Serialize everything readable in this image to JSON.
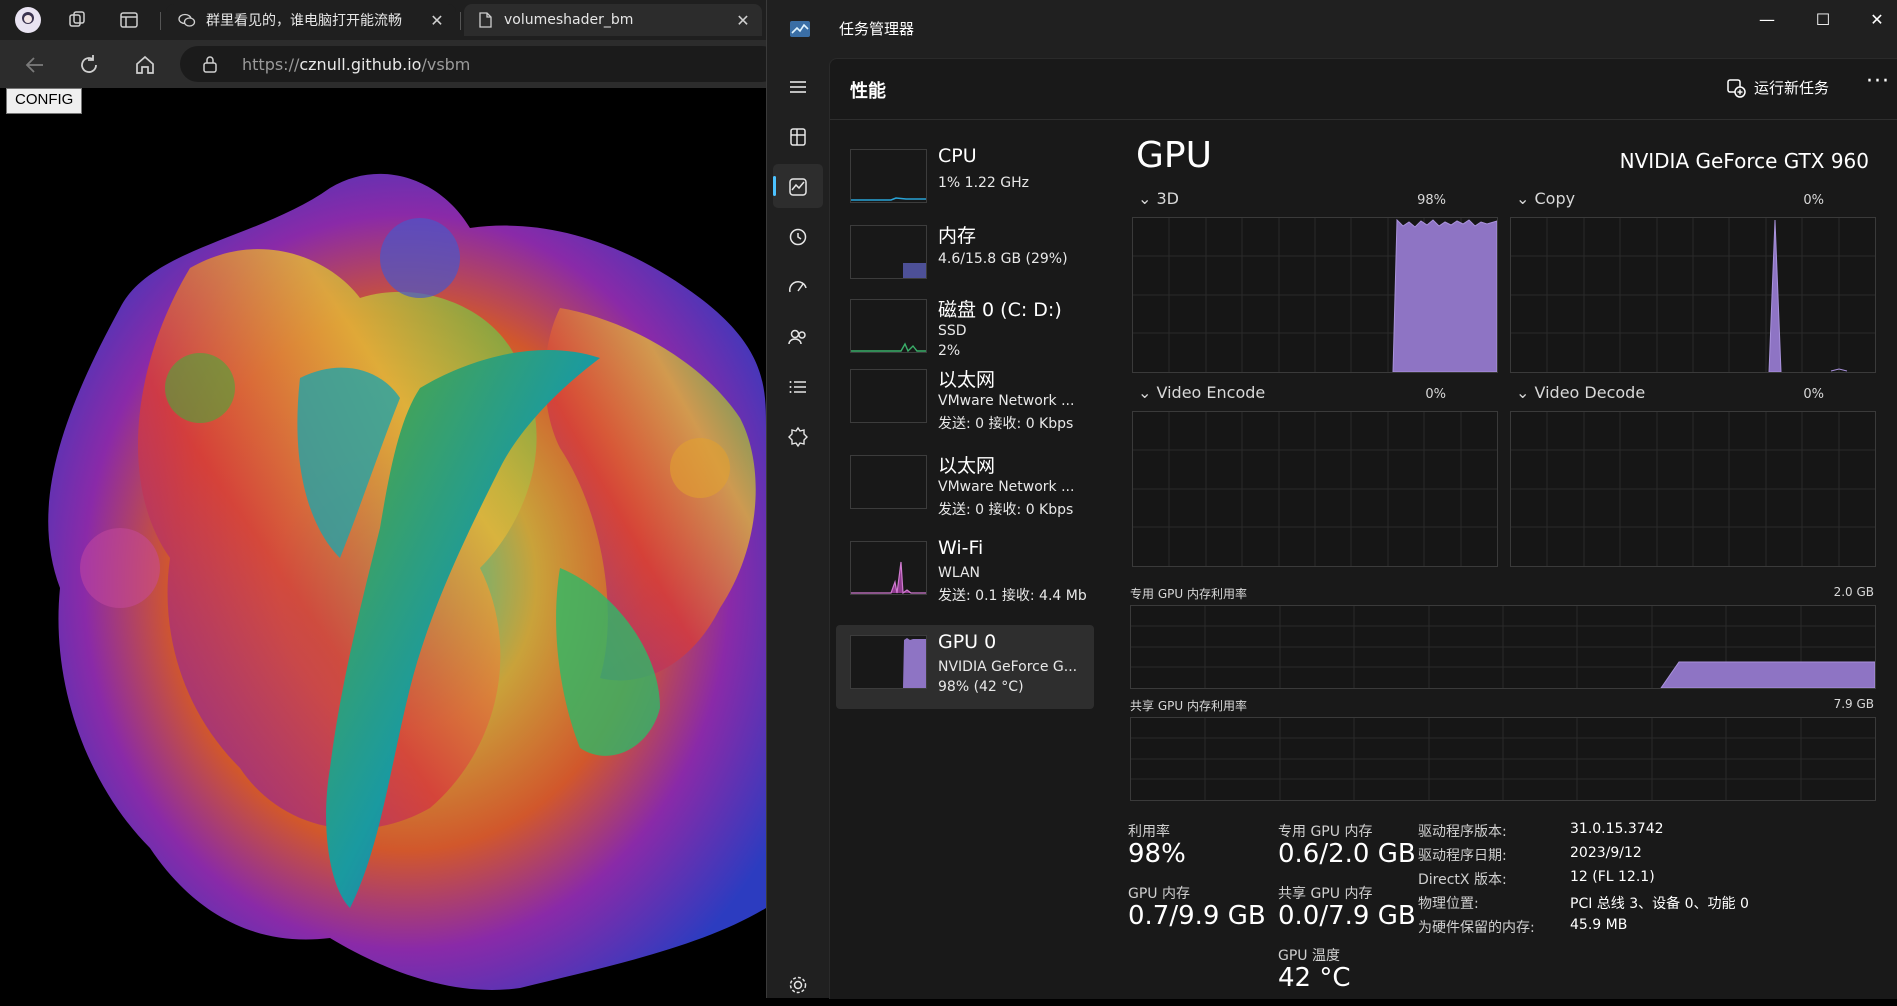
{
  "browser": {
    "tabs": [
      {
        "title": "群里看见的，谁电脑打开能流畅",
        "icon": "chat-icon"
      },
      {
        "title": "volumeshader_bm",
        "icon": "page-icon"
      }
    ],
    "url": {
      "scheme": "https://",
      "host": "cznull.github.io",
      "path": "/vsbm"
    },
    "config_label": "CONFIG"
  },
  "taskmanager": {
    "title": "任务管理器",
    "page_title": "性能",
    "run_task_label": "运行新任务",
    "more_label": "···",
    "sidebar": [
      {
        "name": "CPU",
        "sub1": "1% 1.22 GHz",
        "sub2": ""
      },
      {
        "name": "内存",
        "sub1": "4.6/15.8 GB (29%)",
        "sub2": ""
      },
      {
        "name": "磁盘 0 (C: D:)",
        "sub1": "SSD",
        "sub2": "2%"
      },
      {
        "name": "以太网",
        "sub1": "VMware Network ...",
        "sub2": "发送: 0 接收: 0 Kbps"
      },
      {
        "name": "以太网",
        "sub1": "VMware Network ...",
        "sub2": "发送: 0 接收: 0 Kbps"
      },
      {
        "name": "Wi-Fi",
        "sub1": "WLAN",
        "sub2": "发送: 0.1 接收: 4.4 Mb"
      },
      {
        "name": "GPU 0",
        "sub1": "NVIDIA GeForce G...",
        "sub2": "98% (42 °C)"
      }
    ],
    "gpu": {
      "title": "GPU",
      "model": "NVIDIA GeForce GTX 960",
      "engines": [
        {
          "label": "3D",
          "pct": "98%"
        },
        {
          "label": "Copy",
          "pct": "0%"
        },
        {
          "label": "Video Encode",
          "pct": "0%"
        },
        {
          "label": "Video Decode",
          "pct": "0%"
        }
      ],
      "dedicated_label": "专用 GPU 内存利用率",
      "dedicated_max": "2.0 GB",
      "shared_label": "共享 GPU 内存利用率",
      "shared_max": "7.9 GB",
      "stats": {
        "util_label": "利用率",
        "util_value": "98%",
        "dedmem_label": "专用 GPU 内存",
        "dedmem_value": "0.6/2.0 GB",
        "gpumem_label": "GPU 内存",
        "gpumem_value": "0.7/9.9 GB",
        "sharedmem_label": "共享 GPU 内存",
        "sharedmem_value": "0.0/7.9 GB",
        "temp_label": "GPU 温度",
        "temp_value": "42 °C"
      },
      "details": [
        {
          "k": "驱动程序版本:",
          "v": "31.0.15.3742"
        },
        {
          "k": "驱动程序日期:",
          "v": "2023/9/12"
        },
        {
          "k": "DirectX 版本:",
          "v": "12 (FL 12.1)"
        },
        {
          "k": "物理位置:",
          "v": "PCI 总线 3、设备 0、功能 0"
        },
        {
          "k": "为硬件保留的内存:",
          "v": "45.9 MB"
        }
      ]
    },
    "accent": "#4cc2ff",
    "graph_color": "#9b7ed0"
  }
}
